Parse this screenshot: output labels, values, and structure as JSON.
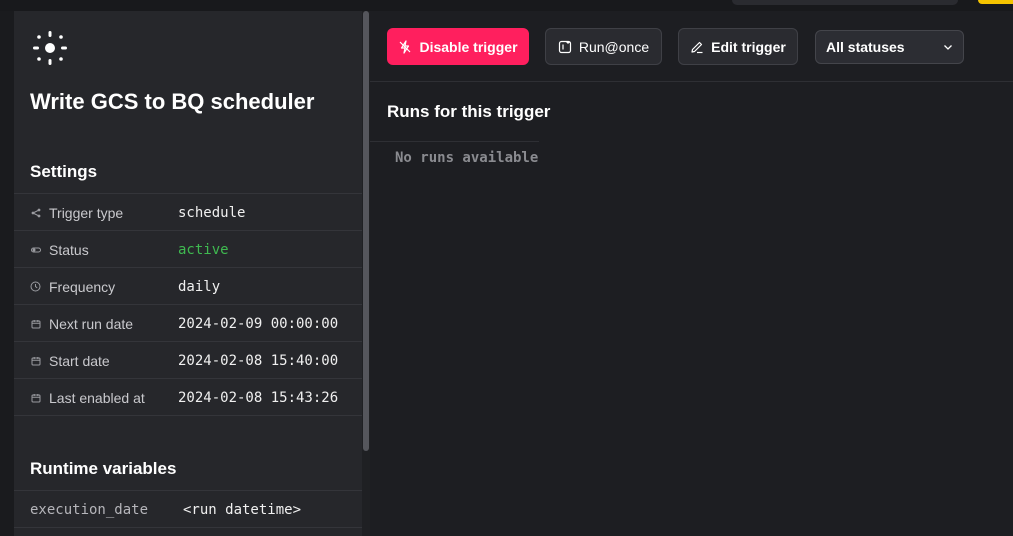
{
  "trigger": {
    "title": "Write GCS to BQ scheduler"
  },
  "settings": {
    "heading": "Settings",
    "rows": [
      {
        "label": "Trigger type",
        "value": "schedule",
        "icon": "share-icon"
      },
      {
        "label": "Status",
        "value": "active",
        "icon": "toggle-icon"
      },
      {
        "label": "Frequency",
        "value": "daily",
        "icon": "clock-icon"
      },
      {
        "label": "Next run date",
        "value": "2024-02-09 00:00:00",
        "icon": "calendar-icon"
      },
      {
        "label": "Start date",
        "value": "2024-02-08 15:40:00",
        "icon": "calendar-icon"
      },
      {
        "label": "Last enabled at",
        "value": "2024-02-08 15:43:26",
        "icon": "calendar-icon"
      }
    ]
  },
  "runtime": {
    "heading": "Runtime variables",
    "rows": [
      {
        "key": "execution_date",
        "value": "<run datetime>"
      }
    ]
  },
  "toolbar": {
    "disable_label": "Disable trigger",
    "run_once_label": "Run@once",
    "edit_label": "Edit trigger",
    "status_filter": "All statuses"
  },
  "runs": {
    "heading": "Runs for this trigger",
    "empty_text": "No runs available"
  },
  "colors": {
    "accent": "#ff1f5e",
    "active_status": "#3fb950",
    "background": "#1d1e22",
    "sidebar": "#26272b"
  }
}
